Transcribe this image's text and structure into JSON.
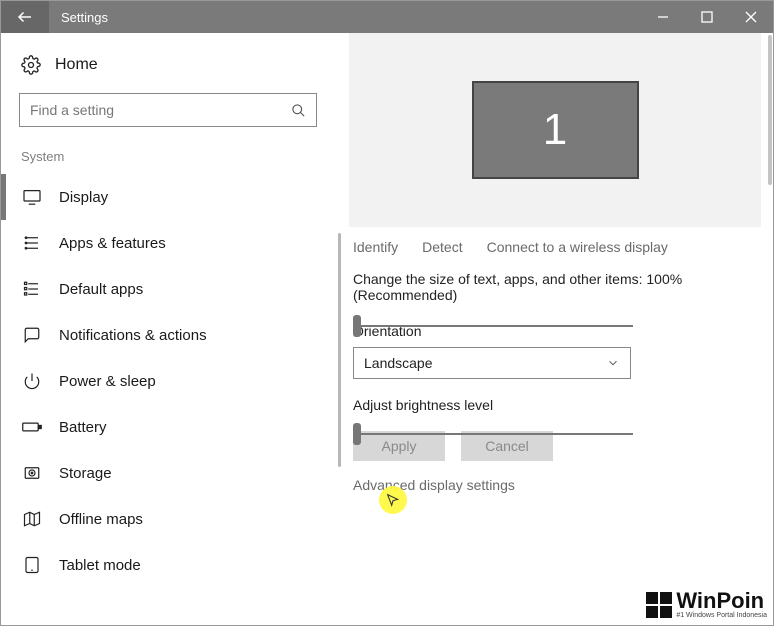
{
  "titlebar": {
    "title": "Settings"
  },
  "home": {
    "label": "Home"
  },
  "search": {
    "placeholder": "Find a setting"
  },
  "section": {
    "label": "System"
  },
  "nav": {
    "items": [
      {
        "label": "Display"
      },
      {
        "label": "Apps & features"
      },
      {
        "label": "Default apps"
      },
      {
        "label": "Notifications & actions"
      },
      {
        "label": "Power & sleep"
      },
      {
        "label": "Battery"
      },
      {
        "label": "Storage"
      },
      {
        "label": "Offline maps"
      },
      {
        "label": "Tablet mode"
      }
    ]
  },
  "preview": {
    "monitor": "1"
  },
  "actions": {
    "identify": "Identify",
    "detect": "Detect",
    "connect": "Connect to a wireless display"
  },
  "scale": {
    "label": "Change the size of text, apps, and other items: 100% (Recommended)",
    "value_pct": 0
  },
  "orientation": {
    "label": "Orientation",
    "value": "Landscape"
  },
  "brightness": {
    "label": "Adjust brightness level",
    "value_pct": 0
  },
  "buttons": {
    "apply": "Apply",
    "cancel": "Cancel"
  },
  "advanced": {
    "label": "Advanced display settings"
  },
  "watermark": {
    "brand": "WinPoin",
    "tagline": "#1 Windows Portal Indonesia"
  }
}
